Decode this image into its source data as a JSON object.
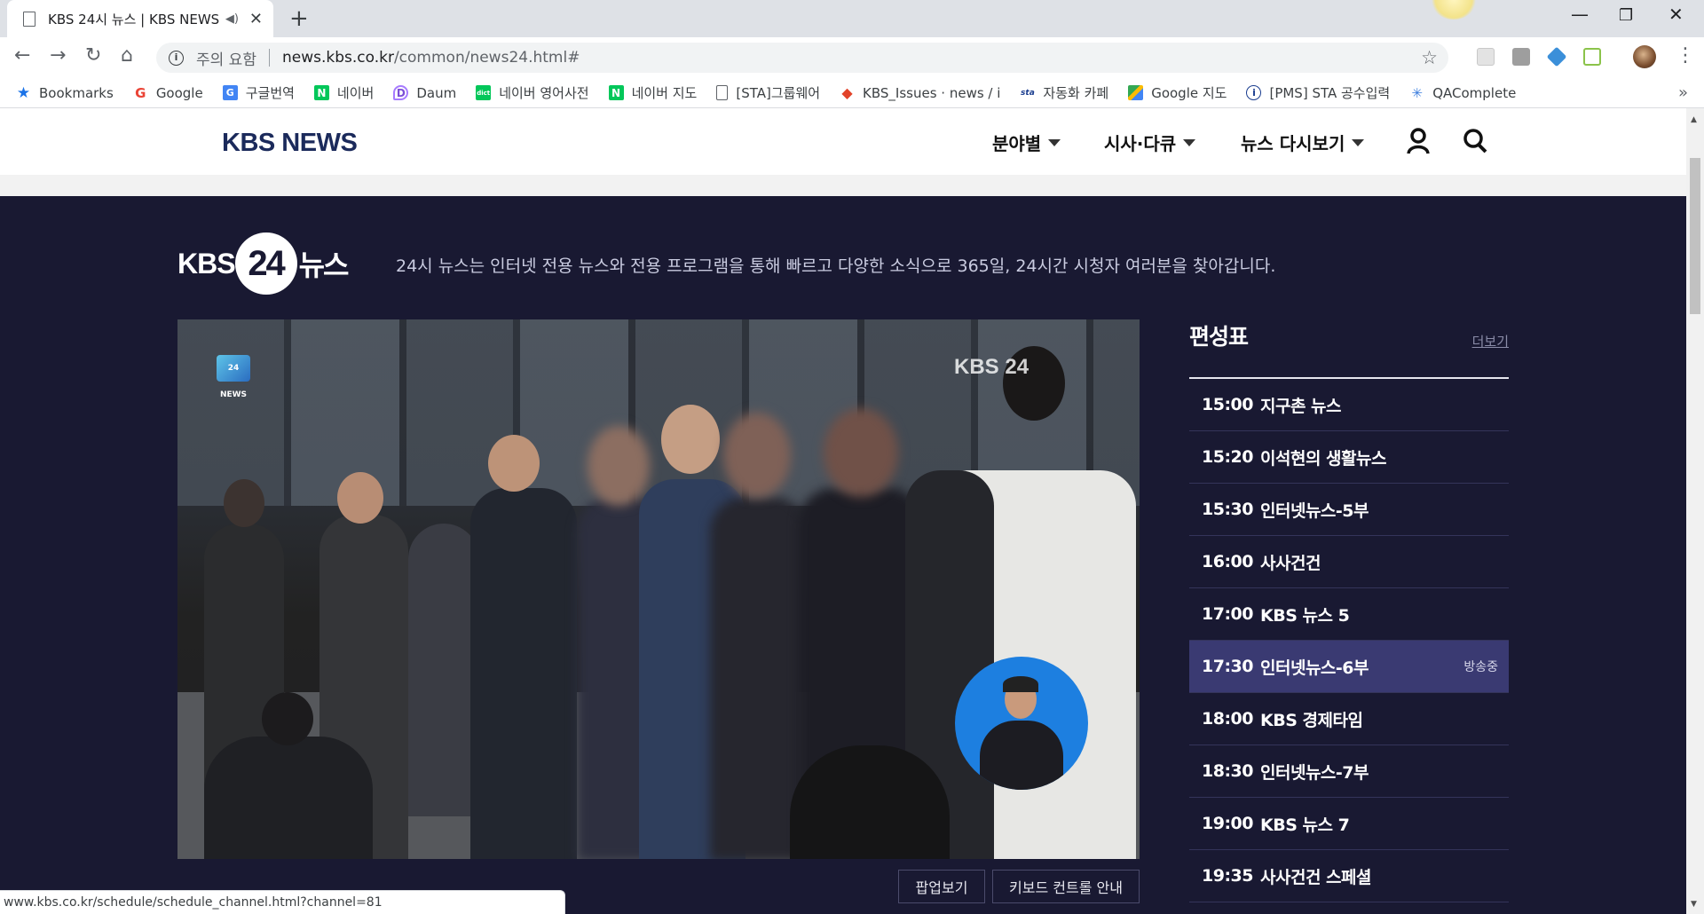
{
  "browser": {
    "tab_title": "KBS 24시 뉴스 | KBS NEWS",
    "url_warning": "주의 요함",
    "url_host": "news.kbs.co.kr",
    "url_path": "/common/news24.html#",
    "status_url": "www.kbs.co.kr/schedule/schedule_channel.html?channel=81",
    "bookmarks": [
      {
        "label": "Bookmarks",
        "icon": "star-icon"
      },
      {
        "label": "Google",
        "icon": "google-icon"
      },
      {
        "label": "구글번역",
        "icon": "google-translate-icon"
      },
      {
        "label": "네이버",
        "icon": "naver-icon"
      },
      {
        "label": "Daum",
        "icon": "daum-icon"
      },
      {
        "label": "네이버 영어사전",
        "icon": "naver-dict-icon"
      },
      {
        "label": "네이버 지도",
        "icon": "naver-map-icon"
      },
      {
        "label": "[STA]그룹웨어",
        "icon": "page-icon"
      },
      {
        "label": "KBS_Issues · news / i",
        "icon": "gitlab-icon"
      },
      {
        "label": "자동화 카페",
        "icon": "cafe-icon"
      },
      {
        "label": "Google 지도",
        "icon": "google-maps-icon"
      },
      {
        "label": "[PMS] STA 공수입력",
        "icon": "pms-icon"
      },
      {
        "label": "QAComplete",
        "icon": "qacomplete-icon"
      }
    ],
    "more_bookmarks": "»"
  },
  "site": {
    "logo": "KBS NEWS",
    "nav": [
      {
        "label": "분야별"
      },
      {
        "label": "시사·다큐"
      },
      {
        "label": "뉴스 다시보기"
      }
    ]
  },
  "brand": {
    "kbs": "KBS",
    "num": "24",
    "kor": "뉴스",
    "description": "24시 뉴스는 인터넷 전용 뉴스와 전용 프로그램을 통해 빠르고 다양한 소식으로 365일, 24시간 시청자 여러분을 찾아갑니다."
  },
  "player": {
    "channel_logo": "24 NEWS",
    "watermark": "KBS 24",
    "popup_button": "팝업보기",
    "keyboard_button": "키보드 컨트롤 안내"
  },
  "schedule": {
    "title": "편성표",
    "more": "더보기",
    "items": [
      {
        "time": "15:00",
        "program": "지구촌 뉴스",
        "live": ""
      },
      {
        "time": "15:20",
        "program": "이석현의 생활뉴스",
        "live": ""
      },
      {
        "time": "15:30",
        "program": "인터넷뉴스-5부",
        "live": ""
      },
      {
        "time": "16:00",
        "program": "사사건건",
        "live": ""
      },
      {
        "time": "17:00",
        "program": "KBS 뉴스 5",
        "live": ""
      },
      {
        "time": "17:30",
        "program": "인터넷뉴스-6부",
        "live": "방송중"
      },
      {
        "time": "18:00",
        "program": "KBS 경제타임",
        "live": ""
      },
      {
        "time": "18:30",
        "program": "인터넷뉴스-7부",
        "live": ""
      },
      {
        "time": "19:00",
        "program": "KBS 뉴스 7",
        "live": ""
      },
      {
        "time": "19:35",
        "program": "사사건건 스페셜",
        "live": ""
      }
    ]
  },
  "colors": {
    "page_bg": "#191932",
    "live_row_bg": "#3a3a72",
    "logo_color": "#1b2a5b"
  }
}
